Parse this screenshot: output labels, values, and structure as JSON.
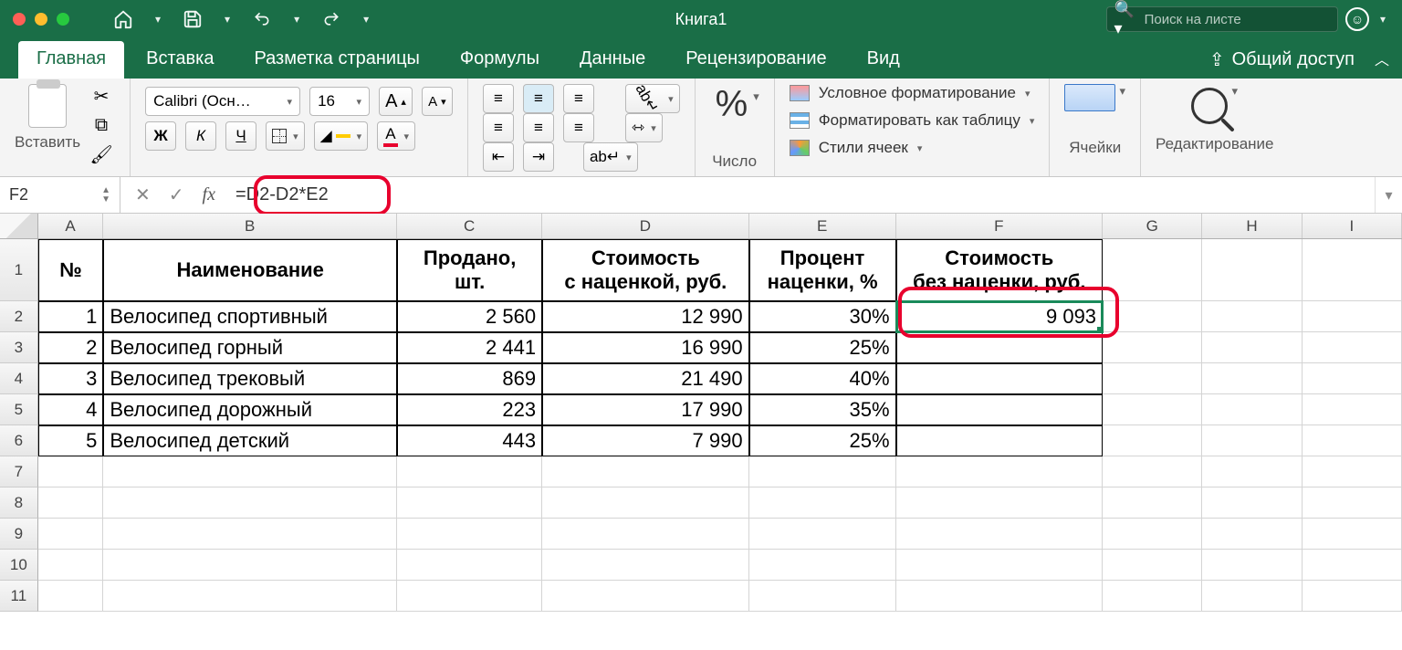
{
  "window": {
    "title": "Книга1",
    "search_placeholder": "Поиск на листе"
  },
  "tabs": {
    "items": [
      "Главная",
      "Вставка",
      "Разметка страницы",
      "Формулы",
      "Данные",
      "Рецензирование",
      "Вид"
    ],
    "share": "Общий доступ"
  },
  "ribbon": {
    "paste_label": "Вставить",
    "font_name": "Calibri (Осн…",
    "font_size": "16",
    "bold": "Ж",
    "italic": "К",
    "underline": "Ч",
    "increase_font": "A",
    "decrease_font": "A",
    "fill_letter": "A",
    "font_color_letter": "A",
    "wrap_glyph": "ab↵",
    "number_label": "Число",
    "cond_fmt": "Условное форматирование",
    "fmt_table": "Форматировать как таблицу",
    "cell_styles": "Стили ячеек",
    "cells_label": "Ячейки",
    "editing_label": "Редактирование"
  },
  "namebar": {
    "cell_ref": "F2",
    "fx": "fx",
    "formula": "=D2-D2*E2"
  },
  "columns": [
    "A",
    "B",
    "C",
    "D",
    "E",
    "F",
    "G",
    "H",
    "I"
  ],
  "row_labels": [
    "1",
    "2",
    "3",
    "4",
    "5",
    "6",
    "7",
    "8",
    "9",
    "10",
    "11"
  ],
  "table": {
    "headers": {
      "num": "№",
      "name": "Наименование",
      "sold": "Продано,\nшт.",
      "cost_with": "Стоимость\nс наценкой, руб.",
      "markup_pct": "Процент\nнаценки, %",
      "cost_without": "Стоимость\nбез наценки, руб."
    },
    "rows": [
      {
        "n": "1",
        "name": "Велосипед спортивный",
        "sold": "2 560",
        "cost_with": "12 990",
        "pct": "30%",
        "cost_wo": "9 093"
      },
      {
        "n": "2",
        "name": "Велосипед горный",
        "sold": "2 441",
        "cost_with": "16 990",
        "pct": "25%",
        "cost_wo": ""
      },
      {
        "n": "3",
        "name": "Велосипед трековый",
        "sold": "869",
        "cost_with": "21 490",
        "pct": "40%",
        "cost_wo": ""
      },
      {
        "n": "4",
        "name": "Велосипед дорожный",
        "sold": "223",
        "cost_with": "17 990",
        "pct": "35%",
        "cost_wo": ""
      },
      {
        "n": "5",
        "name": "Велосипед детский",
        "sold": "443",
        "cost_with": "7 990",
        "pct": "25%",
        "cost_wo": ""
      }
    ]
  },
  "chart_data": {
    "type": "table",
    "headers": [
      "№",
      "Наименование",
      "Продано, шт.",
      "Стоимость с наценкой, руб.",
      "Процент наценки, %",
      "Стоимость без наценки, руб."
    ],
    "rows": [
      [
        1,
        "Велосипед спортивный",
        2560,
        12990,
        0.3,
        9093
      ],
      [
        2,
        "Велосипед горный",
        2441,
        16990,
        0.25,
        null
      ],
      [
        3,
        "Велосипед трековый",
        869,
        21490,
        0.4,
        null
      ],
      [
        4,
        "Велосипед дорожный",
        223,
        17990,
        0.35,
        null
      ],
      [
        5,
        "Велосипед детский",
        443,
        7990,
        0.25,
        null
      ]
    ]
  }
}
